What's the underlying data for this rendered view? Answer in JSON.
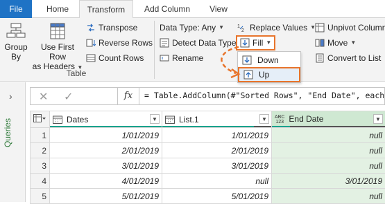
{
  "tabs": [
    "File",
    "Home",
    "Transform",
    "Add Column",
    "View"
  ],
  "ribbon": {
    "group_by": [
      "Group",
      "By"
    ],
    "use_first_row": [
      "Use First Row",
      "as Headers"
    ],
    "transpose": "Transpose",
    "reverse_rows": "Reverse Rows",
    "count_rows": "Count Rows",
    "table_group": "Table",
    "data_type": "Data Type: Any",
    "detect_data_type": "Detect Data Type",
    "rename": "Rename",
    "replace_values": "Replace Values",
    "fill": "Fill",
    "unpivot_columns": "Unpivot Column",
    "move": "Move",
    "convert_to_list": "Convert to List",
    "fill_menu": [
      "Down",
      "Up"
    ]
  },
  "queries_label": "Queries",
  "formula": "= Table.AddColumn(#\"Sorted Rows\", \"End Date\", each if [List",
  "table": {
    "columns": [
      "Dates",
      "List.1",
      "End Date"
    ],
    "end_date_type": [
      "ABC",
      "123"
    ],
    "rows": [
      {
        "n": "1",
        "dates": "1/01/2019",
        "list1": "1/01/2019",
        "end": "null"
      },
      {
        "n": "2",
        "dates": "2/01/2019",
        "list1": "2/01/2019",
        "end": "null"
      },
      {
        "n": "3",
        "dates": "3/01/2019",
        "list1": "3/01/2019",
        "end": "null"
      },
      {
        "n": "4",
        "dates": "4/01/2019",
        "list1": "null",
        "end": "3/01/2019"
      },
      {
        "n": "5",
        "dates": "5/01/2019",
        "list1": "5/01/2019",
        "end": "null"
      }
    ]
  },
  "colors": {
    "file_tab": "#1f73c5",
    "highlight": "#e8742b",
    "queries_label": "#2f7a3a",
    "end_date_col": "#e3f1e3"
  }
}
